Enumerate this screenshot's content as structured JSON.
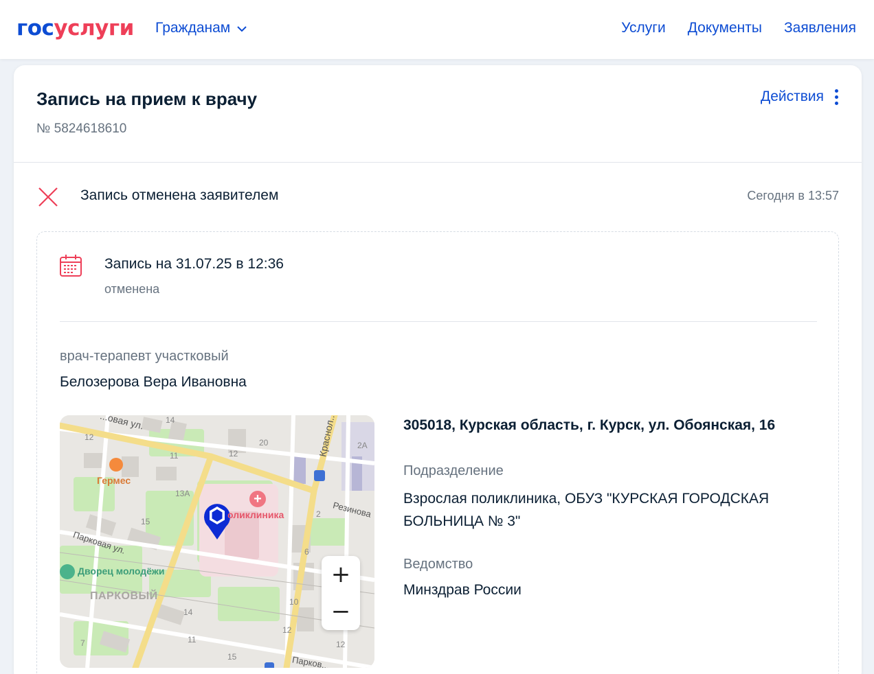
{
  "header": {
    "logo_part1": "гос",
    "logo_part2": "услуги",
    "citizens_label": "Гражданам",
    "links": [
      "Услуги",
      "Документы",
      "Заявления"
    ]
  },
  "order": {
    "title": "Запись на прием к врачу",
    "number": "№ 5824618610",
    "actions_label": "Действия"
  },
  "status": {
    "text": "Запись отменена заявителем",
    "time": "Сегодня в 13:57"
  },
  "appointment": {
    "title": "Запись на 31.07.25 в 12:36",
    "status": "отменена",
    "doctor_role": "врач-терапевт участковый",
    "doctor_name": "Белозерова Вера Ивановна",
    "address": "305018, Курская область, г. Курск, ул. Обоянская, 16",
    "subdivision_label": "Подразделение",
    "subdivision_value": "Взрослая поликлиника, ОБУЗ \"КУРСКАЯ ГОРОДСКАЯ БОЛЬНИЦА № 3\"",
    "department_label": "Ведомство",
    "department_value": "Минздрав России"
  },
  "map": {
    "labels": {
      "street_top": "...овая ул.",
      "street_krasno": "Краснол...",
      "street_rezinova": "Резинова",
      "street_parkovaya": "Парковая ул.",
      "street_parkovaya2": "Парков...",
      "poi_hermes": "Гермес",
      "poi_clinic": "оликлиника",
      "poi_palace": "Дворец молодёжи",
      "district": "ПАРКОВЫЙ"
    },
    "house_numbers": [
      "14",
      "12",
      "11",
      "12",
      "20",
      "2А",
      "13А",
      "15",
      "2",
      "6",
      "10",
      "14",
      "12",
      "11",
      "15",
      "7",
      "12"
    ],
    "zoom_in": "+",
    "zoom_out": "−"
  },
  "colors": {
    "brand_blue": "#0d4cd3",
    "brand_red": "#ee3f58",
    "text_primary": "#0b1f33",
    "text_secondary": "#66727f"
  }
}
